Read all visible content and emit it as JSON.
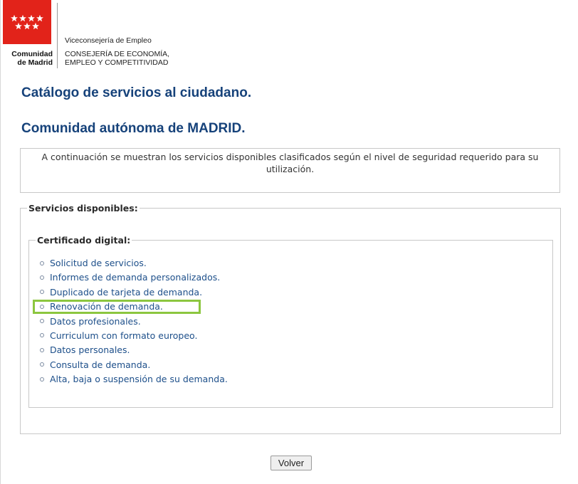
{
  "header": {
    "logo": {
      "text_line1": "Comunidad",
      "text_line2": "de Madrid",
      "flag_color": "#e2231a"
    },
    "department": {
      "subtitle": "Viceconsejería de Empleo",
      "line1": "CONSEJERÍA DE ECONOMÍA,",
      "line2": "EMPLEO Y COMPETITIVIDAD"
    }
  },
  "titles": {
    "catalog": "Catálogo de servicios al ciudadano.",
    "region": "Comunidad autónoma de MADRID."
  },
  "info": {
    "text": "A continuación se muestran los servicios disponibles clasificados según el nivel de seguridad requerido para su utilización."
  },
  "services": {
    "legend": "Servicios disponibles:",
    "certificate": {
      "legend": "Certificado digital:",
      "items": [
        "Solicitud de servicios.",
        "Informes de demanda personalizados.",
        "Duplicado de tarjeta de demanda.",
        "Renovación de demanda.",
        "Datos profesionales.",
        "Curriculum con formato europeo.",
        "Datos personales.",
        "Consulta de demanda.",
        "Alta, baja o suspensión de su demanda."
      ],
      "highlighted_item": "Renovación de demanda.",
      "highlight_color": "#8cc63f"
    }
  },
  "actions": {
    "back_label": "Volver"
  },
  "colors": {
    "title": "#16427a",
    "link": "#1d4f8a"
  }
}
